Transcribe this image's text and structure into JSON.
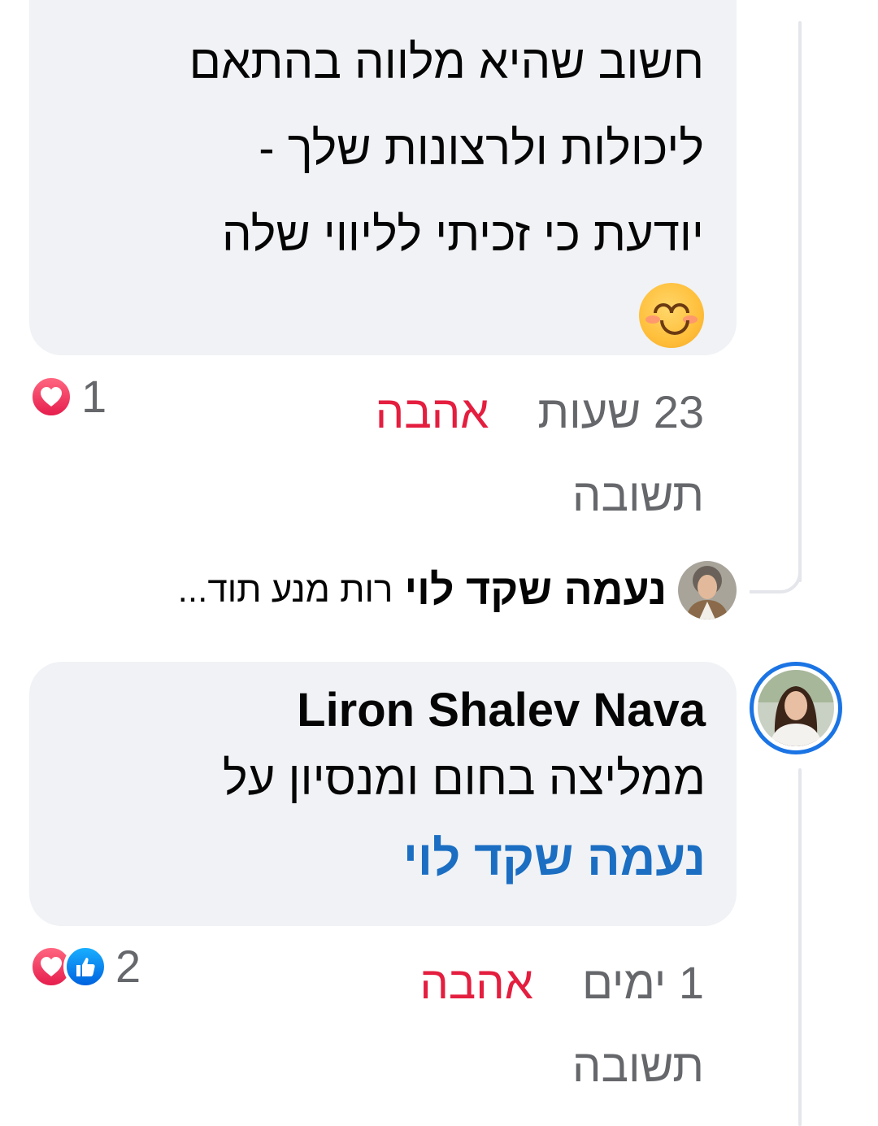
{
  "comment1": {
    "lines": [
      "חשוב שהיא מלווה בהתאם",
      "ליכולות ולרצונות שלך -",
      "יודעת כי זכיתי לליווי שלה"
    ],
    "emoji": "smiling-face-with-blush",
    "reactions": {
      "count": "1",
      "types": [
        "love"
      ]
    },
    "time": "23 שעות",
    "love_label": "אהבה",
    "reply_label": "תשובה"
  },
  "reply_summary": {
    "name": "נעמה שקד לוי",
    "text": "רות מנע תוד..."
  },
  "comment2": {
    "author": "Liron Shalev Nava",
    "lines": [
      "ממליצה בחום ומנסיון על"
    ],
    "mention": "נעמה שקד לוי",
    "reactions": {
      "count": "2",
      "types": [
        "love",
        "like"
      ]
    },
    "time": "1 ימים",
    "love_label": "אהבה",
    "reply_label": "תשובה"
  },
  "colors": {
    "bubble": "#f0f2f5",
    "love": "#e41e3f",
    "mention": "#1b6ec2",
    "meta": "#65676b",
    "story_ring": "#1b74e4"
  }
}
